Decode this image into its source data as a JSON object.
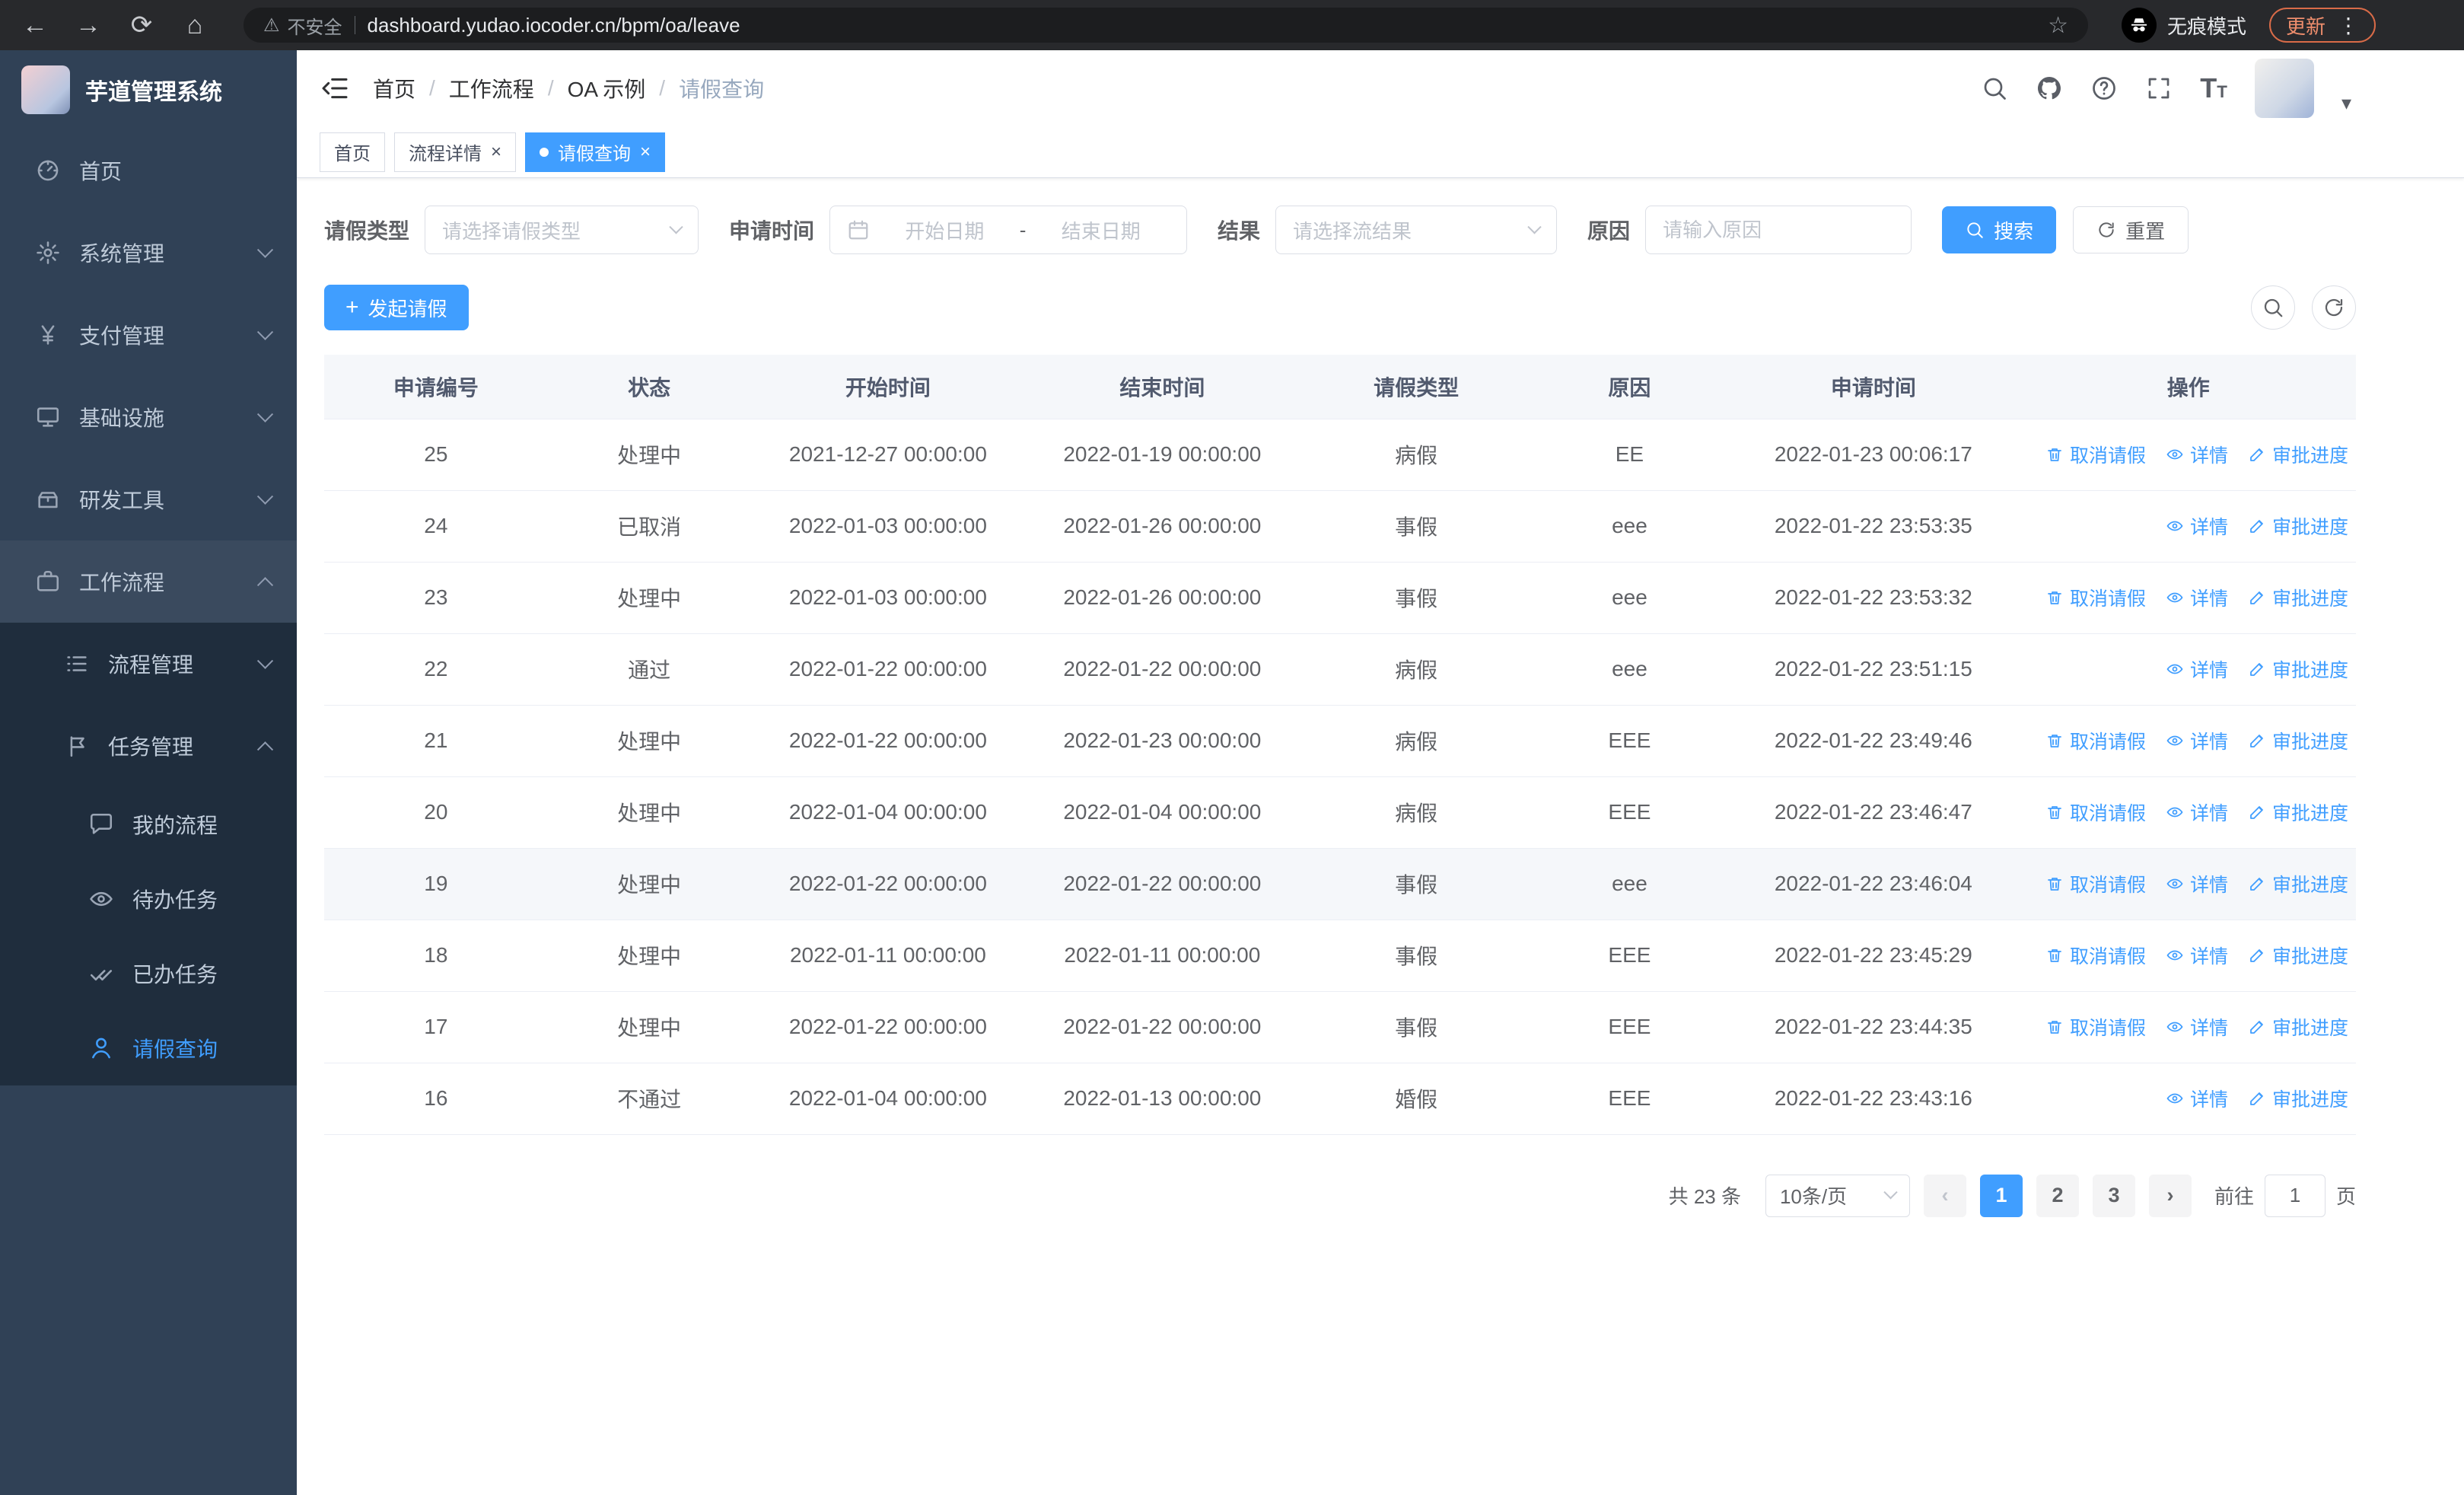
{
  "colors": {
    "primary": "#409eff",
    "sidebar_bg": "#304156",
    "submenu_bg": "#1f2d3d",
    "update_accent": "#d96b48"
  },
  "browser": {
    "security_label": "不安全",
    "url": "dashboard.yudao.iocoder.cn/bpm/oa/leave",
    "incognito_label": "无痕模式",
    "update_label": "更新"
  },
  "sidebar": {
    "title": "芋道管理系统",
    "menu": [
      {
        "label": "首页",
        "icon": "dashboard-icon",
        "level": 0,
        "chevron": null,
        "sub": false,
        "open": false,
        "active": false
      },
      {
        "label": "系统管理",
        "icon": "gear-icon",
        "level": 0,
        "chevron": "down",
        "sub": false,
        "open": false,
        "active": false
      },
      {
        "label": "支付管理",
        "icon": "yen-icon",
        "level": 0,
        "chevron": "down",
        "sub": false,
        "open": false,
        "active": false
      },
      {
        "label": "基础设施",
        "icon": "infra-icon",
        "level": 0,
        "chevron": "down",
        "sub": false,
        "open": false,
        "active": false
      },
      {
        "label": "研发工具",
        "icon": "tools-icon",
        "level": 0,
        "chevron": "down",
        "sub": false,
        "open": false,
        "active": false
      },
      {
        "label": "工作流程",
        "icon": "workflow-icon",
        "level": 0,
        "chevron": "up",
        "sub": false,
        "open": true,
        "active": false
      },
      {
        "label": "流程管理",
        "icon": "process-list-icon",
        "level": 1,
        "chevron": "down",
        "sub": true,
        "open": false,
        "active": false
      },
      {
        "label": "任务管理",
        "icon": "task-icon",
        "level": 1,
        "chevron": "up",
        "sub": true,
        "open": false,
        "active": false
      },
      {
        "label": "我的流程",
        "icon": "chat-icon",
        "level": 2,
        "chevron": null,
        "sub": true,
        "open": false,
        "active": false
      },
      {
        "label": "待办任务",
        "icon": "eye-icon",
        "level": 2,
        "chevron": null,
        "sub": true,
        "open": false,
        "active": false
      },
      {
        "label": "已办任务",
        "icon": "check-icon",
        "level": 2,
        "chevron": null,
        "sub": true,
        "open": false,
        "active": false
      },
      {
        "label": "请假查询",
        "icon": "user-icon",
        "level": 2,
        "chevron": null,
        "sub": true,
        "open": false,
        "active": true
      }
    ]
  },
  "header": {
    "breadcrumb": [
      "首页",
      "工作流程",
      "OA 示例",
      "请假查询"
    ]
  },
  "tabs": [
    {
      "label": "首页",
      "closable": false,
      "active": false
    },
    {
      "label": "流程详情",
      "closable": true,
      "active": false
    },
    {
      "label": "请假查询",
      "closable": true,
      "active": true
    }
  ],
  "filters": {
    "leave_type_label": "请假类型",
    "leave_type_placeholder": "请选择请假类型",
    "apply_time_label": "申请时间",
    "start_date_placeholder": "开始日期",
    "date_separator": "-",
    "end_date_placeholder": "结束日期",
    "result_label": "结果",
    "result_placeholder": "请选择流结果",
    "reason_label": "原因",
    "reason_placeholder": "请输入原因",
    "search_button": "搜索",
    "reset_button": "重置"
  },
  "toolbar": {
    "create_button": "发起请假"
  },
  "table": {
    "columns": [
      "申请编号",
      "状态",
      "开始时间",
      "结束时间",
      "请假类型",
      "原因",
      "申请时间",
      "操作"
    ],
    "action_labels": {
      "cancel": "取消请假",
      "detail": "详情",
      "progress": "审批进度"
    },
    "rows": [
      {
        "id": "25",
        "status": "处理中",
        "start": "2021-12-27 00:00:00",
        "end": "2022-01-19 00:00:00",
        "type": "病假",
        "reason": "EE",
        "applied": "2022-01-23 00:06:17",
        "actions": [
          "cancel",
          "detail",
          "progress"
        ],
        "highlight": false
      },
      {
        "id": "24",
        "status": "已取消",
        "start": "2022-01-03 00:00:00",
        "end": "2022-01-26 00:00:00",
        "type": "事假",
        "reason": "eee",
        "applied": "2022-01-22 23:53:35",
        "actions": [
          "detail",
          "progress"
        ],
        "highlight": false
      },
      {
        "id": "23",
        "status": "处理中",
        "start": "2022-01-03 00:00:00",
        "end": "2022-01-26 00:00:00",
        "type": "事假",
        "reason": "eee",
        "applied": "2022-01-22 23:53:32",
        "actions": [
          "cancel",
          "detail",
          "progress"
        ],
        "highlight": false
      },
      {
        "id": "22",
        "status": "通过",
        "start": "2022-01-22 00:00:00",
        "end": "2022-01-22 00:00:00",
        "type": "病假",
        "reason": "eee",
        "applied": "2022-01-22 23:51:15",
        "actions": [
          "detail",
          "progress"
        ],
        "highlight": false
      },
      {
        "id": "21",
        "status": "处理中",
        "start": "2022-01-22 00:00:00",
        "end": "2022-01-23 00:00:00",
        "type": "病假",
        "reason": "EEE",
        "applied": "2022-01-22 23:49:46",
        "actions": [
          "cancel",
          "detail",
          "progress"
        ],
        "highlight": false
      },
      {
        "id": "20",
        "status": "处理中",
        "start": "2022-01-04 00:00:00",
        "end": "2022-01-04 00:00:00",
        "type": "病假",
        "reason": "EEE",
        "applied": "2022-01-22 23:46:47",
        "actions": [
          "cancel",
          "detail",
          "progress"
        ],
        "highlight": false
      },
      {
        "id": "19",
        "status": "处理中",
        "start": "2022-01-22 00:00:00",
        "end": "2022-01-22 00:00:00",
        "type": "事假",
        "reason": "eee",
        "applied": "2022-01-22 23:46:04",
        "actions": [
          "cancel",
          "detail",
          "progress"
        ],
        "highlight": true
      },
      {
        "id": "18",
        "status": "处理中",
        "start": "2022-01-11 00:00:00",
        "end": "2022-01-11 00:00:00",
        "type": "事假",
        "reason": "EEE",
        "applied": "2022-01-22 23:45:29",
        "actions": [
          "cancel",
          "detail",
          "progress"
        ],
        "highlight": false
      },
      {
        "id": "17",
        "status": "处理中",
        "start": "2022-01-22 00:00:00",
        "end": "2022-01-22 00:00:00",
        "type": "事假",
        "reason": "EEE",
        "applied": "2022-01-22 23:44:35",
        "actions": [
          "cancel",
          "detail",
          "progress"
        ],
        "highlight": false
      },
      {
        "id": "16",
        "status": "不通过",
        "start": "2022-01-04 00:00:00",
        "end": "2022-01-13 00:00:00",
        "type": "婚假",
        "reason": "EEE",
        "applied": "2022-01-22 23:43:16",
        "actions": [
          "detail",
          "progress"
        ],
        "highlight": false
      }
    ]
  },
  "pagination": {
    "total_text": "共 23 条",
    "page_size": "10条/页",
    "pages": [
      "1",
      "2",
      "3"
    ],
    "current_page": "1",
    "jump_prefix": "前往",
    "jump_value": "1",
    "jump_suffix": "页"
  }
}
